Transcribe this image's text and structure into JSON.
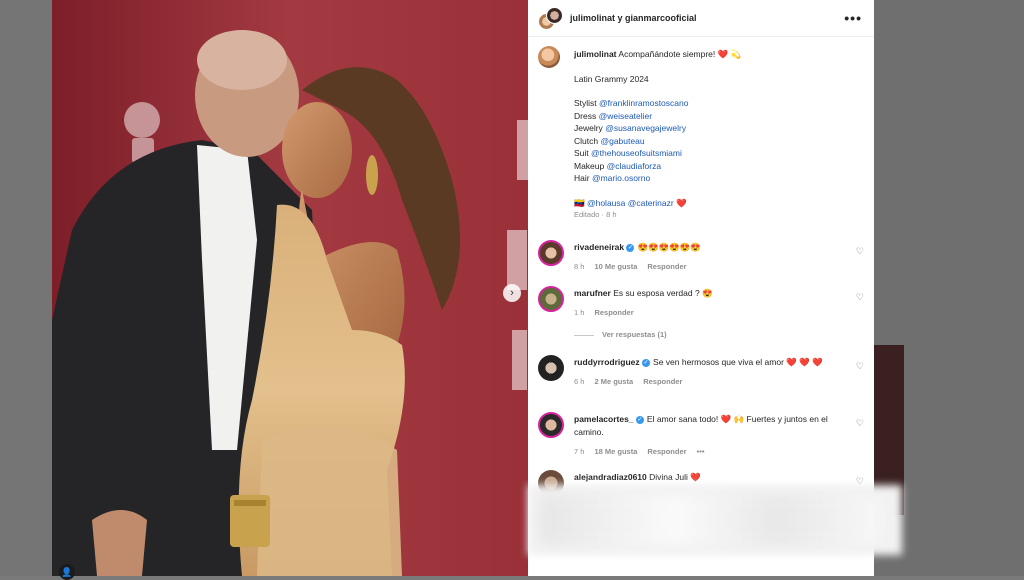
{
  "post": {
    "header_accounts": "julimolinat y gianmarcooficial",
    "more_label": "•••",
    "next_label": "›"
  },
  "caption": {
    "username": "julimolinat",
    "text": "Acompañándote siempre!",
    "emoji": "❤️ 💫",
    "event": "Latin Grammy 2024",
    "credits": [
      {
        "label": "Stylist",
        "handle": "@franklinramostoscano"
      },
      {
        "label": "Dress",
        "handle": "@weiseatelier"
      },
      {
        "label": "Jewelry",
        "handle": "@susanavegajewelry"
      },
      {
        "label": "Clutch",
        "handle": "@gabuteau"
      },
      {
        "label": "Suit",
        "handle": "@thehouseofsuitsmiami"
      },
      {
        "label": "Makeup",
        "handle": "@claudiaforza"
      },
      {
        "label": "Hair",
        "handle": "@mario.osorno"
      }
    ],
    "tag_flag": "🇻🇪",
    "tags": [
      "@holausa",
      "@caterinazr"
    ],
    "tags_emoji": "❤️",
    "edited": "Editado · 8 h"
  },
  "comments": [
    {
      "username": "rivadeneirak",
      "verified": true,
      "text": "😍😍😍😍😍😍",
      "time": "8 h",
      "likes": "10 Me gusta",
      "reply": "Responder"
    },
    {
      "username": "marufner",
      "verified": false,
      "text": "Es su esposa verdad ? 😍",
      "time": "1 h",
      "likes": "",
      "reply": "Responder"
    },
    {
      "username": "ruddyrrodriguez",
      "verified": true,
      "text": "Se ven hermosos que viva el amor ❤️ ❤️ ❤️",
      "time": "6 h",
      "likes": "2 Me gusta",
      "reply": "Responder"
    },
    {
      "username": "pamelacortes_",
      "verified": true,
      "text": "El amor sana todo! ❤️ 🙌 Fuertes y juntos en el camino.",
      "time": "7 h",
      "likes": "18 Me gusta",
      "reply": "Responder",
      "more": "•••"
    },
    {
      "username": "alejandradiaz0610",
      "verified": false,
      "text": "Divina Juli ❤️",
      "time": "",
      "likes": "",
      "reply": ""
    }
  ],
  "view_replies": "Ver respuestas (1)",
  "icons": {
    "heart": "heart-icon",
    "more": "more-icon",
    "next": "chevron-right-icon",
    "user_tag": "user-tag-icon"
  }
}
